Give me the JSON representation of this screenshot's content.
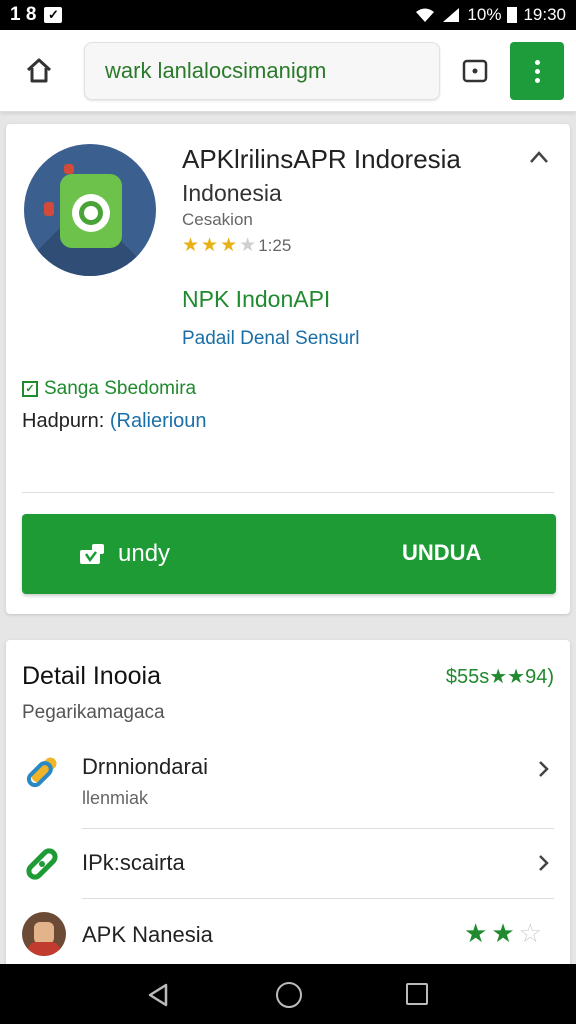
{
  "status_bar": {
    "left_text": "1 8",
    "battery": "10%",
    "time": "19:30"
  },
  "browser": {
    "url": "wark lanlalocsimanigm"
  },
  "app": {
    "title": "APKlrilinsAPR Indoresia",
    "subtitle": "Indonesia",
    "developer": "Cesakion",
    "rating_stars": 3,
    "rating_count": "1:25",
    "tag": "NPK IndonAPI",
    "link": "Padail Denal Sensurl",
    "verified": "Sanga Sbedomira",
    "publisher_label": "Hadpurn:",
    "publisher_value": "(Ralierioun",
    "install_label": "undy",
    "install_label_right": "UNDUA"
  },
  "details": {
    "title": "Detail Inooia",
    "stat": "$55s★★94)",
    "subtitle": "Pegarikamagaca",
    "items": [
      {
        "title": "Drnniondarai",
        "subtitle": "llenmiak"
      },
      {
        "title": "IPk:scairta",
        "subtitle": ""
      },
      {
        "title": "APK Nanesia",
        "subtitle": "",
        "stars": 2
      }
    ]
  },
  "colors": {
    "brand_green": "#1f9b36",
    "link_blue": "#1a6fa8",
    "star_gold": "#e8b216"
  },
  "icons": [
    "home-icon",
    "tab-icon",
    "more-vert-icon",
    "collapse-icon",
    "download-icon",
    "link-icon",
    "chevron-right-icon",
    "back-icon",
    "home-circle-icon",
    "recents-icon"
  ]
}
